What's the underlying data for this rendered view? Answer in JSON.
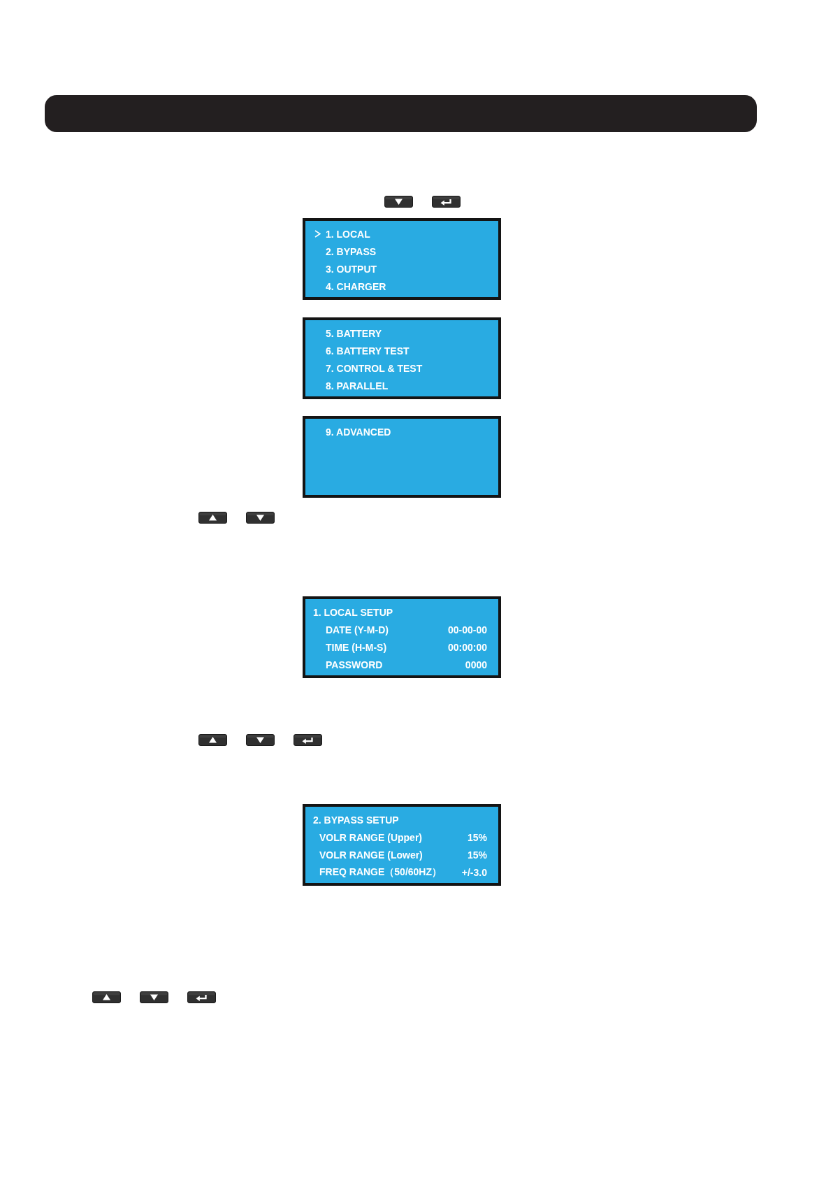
{
  "sections": [
    {
      "keys": [
        {
          "kind": "down"
        },
        {
          "kind": "enter"
        }
      ],
      "screens": [
        {
          "kind": "menu",
          "items": [
            {
              "label": "1. LOCAL",
              "selected": true
            },
            {
              "label": "2. BYPASS",
              "selected": false
            },
            {
              "label": "3. OUTPUT",
              "selected": false
            },
            {
              "label": "4. CHARGER",
              "selected": false
            }
          ]
        },
        {
          "kind": "menu",
          "items": [
            {
              "label": "5. BATTERY",
              "selected": false
            },
            {
              "label": "6. BATTERY TEST",
              "selected": false
            },
            {
              "label": "7. CONTROL & TEST",
              "selected": false
            },
            {
              "label": "8. PARALLEL",
              "selected": false
            }
          ]
        },
        {
          "kind": "menu",
          "items": [
            {
              "label": "9. ADVANCED",
              "selected": false
            }
          ]
        }
      ]
    },
    {
      "keys": [
        {
          "kind": "up"
        },
        {
          "kind": "down"
        }
      ],
      "screens": [
        {
          "kind": "setup",
          "title": "1. LOCAL SETUP",
          "settings": [
            {
              "label": "DATE (Y-M-D)",
              "value": "00-00-00"
            },
            {
              "label": "TIME (H-M-S)",
              "value": "00:00:00"
            },
            {
              "label": "PASSWORD",
              "value": "0000"
            }
          ]
        }
      ]
    },
    {
      "keys": [
        {
          "kind": "up"
        },
        {
          "kind": "down"
        },
        {
          "kind": "enter"
        }
      ],
      "screens": [
        {
          "kind": "setup",
          "title": "2. BYPASS SETUP",
          "settings": [
            {
              "label": "VOLR RANGE (Upper)",
              "value": "15%"
            },
            {
              "label": "VOLR RANGE (Lower)",
              "value": "15%"
            },
            {
              "label": "FREQ RANGE（50/60HZ）",
              "value": "+/-3.0"
            }
          ]
        }
      ]
    },
    {
      "keys": [
        {
          "kind": "up"
        },
        {
          "kind": "down"
        },
        {
          "kind": "enter"
        }
      ]
    }
  ]
}
